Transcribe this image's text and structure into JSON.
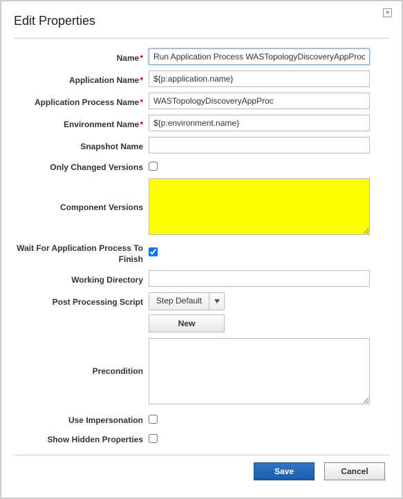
{
  "dialog": {
    "title": "Edit Properties",
    "close_label": "×"
  },
  "fields": {
    "name": {
      "label": "Name",
      "required": true,
      "value": "Run Application Process WASTopologyDiscoveryAppProc"
    },
    "application_name": {
      "label": "Application Name",
      "required": true,
      "value": "${p:application.name}"
    },
    "application_process_name": {
      "label": "Application Process Name",
      "required": true,
      "value": "WASTopologyDiscoveryAppProc"
    },
    "environment_name": {
      "label": "Environment Name",
      "required": true,
      "value": "${p:environment.name}"
    },
    "snapshot_name": {
      "label": "Snapshot Name",
      "required": false,
      "value": ""
    },
    "only_changed_versions": {
      "label": "Only Changed Versions",
      "checked": false
    },
    "component_versions": {
      "label": "Component Versions",
      "value": ""
    },
    "wait_for_finish": {
      "label": "Wait For Application Process To Finish",
      "checked": true
    },
    "working_directory": {
      "label": "Working Directory",
      "value": ""
    },
    "post_processing_script": {
      "label": "Post Processing Script",
      "selected": "Step Default",
      "new_button": "New"
    },
    "precondition": {
      "label": "Precondition",
      "value": ""
    },
    "use_impersonation": {
      "label": "Use Impersonation",
      "checked": false
    },
    "show_hidden_properties": {
      "label": "Show Hidden Properties",
      "checked": false
    }
  },
  "footer": {
    "save": "Save",
    "cancel": "Cancel"
  },
  "colors": {
    "highlight_yellow": "#ffff00",
    "primary_button": "#2f77c5"
  }
}
